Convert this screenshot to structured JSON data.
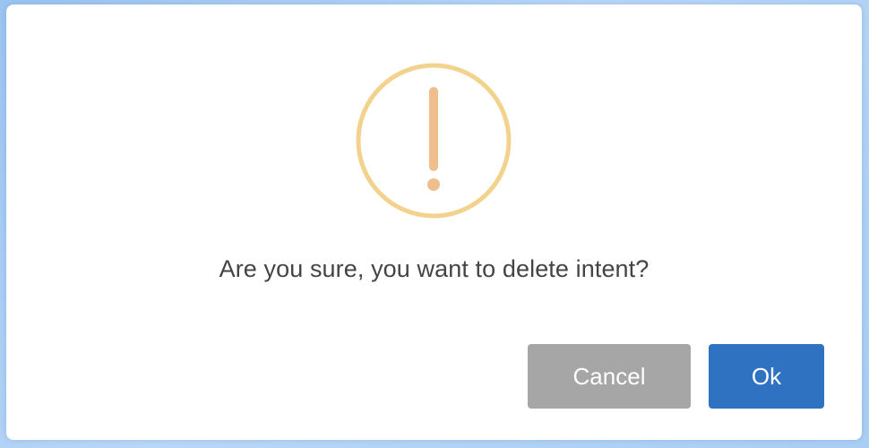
{
  "dialog": {
    "icon": "warning-exclamation-icon",
    "message": "Are you sure, you want to delete intent?",
    "cancel_label": "Cancel",
    "ok_label": "Ok"
  },
  "colors": {
    "icon_ring": "#f3d28e",
    "icon_mark": "#efbe8c",
    "cancel_button": "#a6a6a6",
    "ok_button": "#2f72c2",
    "message_text": "#444444"
  }
}
